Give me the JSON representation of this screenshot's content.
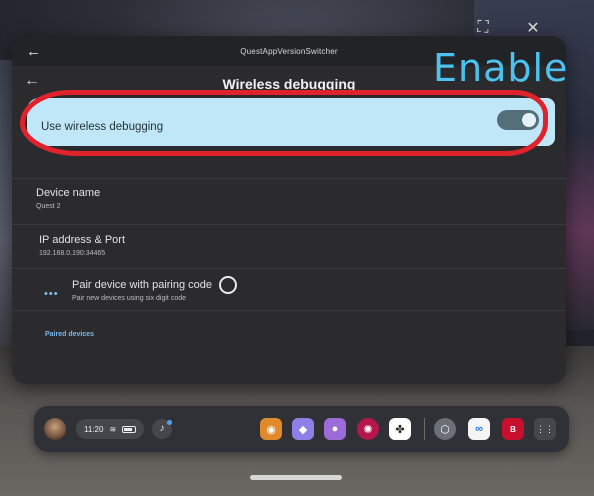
{
  "window": {
    "title": "QuestAppVersionSwitcher",
    "controls": {
      "fullscreen_icon": "⛶",
      "close_icon": "✕"
    }
  },
  "settings": {
    "title": "Wireless debugging",
    "toggle": {
      "label": "Use wireless debugging",
      "state": "on"
    },
    "items": [
      {
        "title": "Device name",
        "subtitle": "Quest 2"
      },
      {
        "title": "IP address & Port",
        "subtitle": "192.168.0.190:34465"
      },
      {
        "title": "Pair device with pairing code",
        "subtitle": "Pair new devices using six digit code"
      }
    ],
    "section_label": "Paired devices"
  },
  "annotation": {
    "text": "Enable",
    "color": "#4cc3ee",
    "outline_color": "#e0222c"
  },
  "taskbar": {
    "time": "11:20",
    "apps": [
      {
        "name": "store-app-icon",
        "color": "#e08a2b",
        "glyph": "◉"
      },
      {
        "name": "explore-app-icon",
        "color": "#8c7fe6",
        "glyph": "◆"
      },
      {
        "name": "people-app-icon",
        "color": "#9b6bd8",
        "glyph": "●"
      },
      {
        "name": "fitness-app-icon",
        "color": "#b5174b",
        "glyph": "✺"
      },
      {
        "name": "mini-app-icon",
        "color": "#ffffff",
        "glyph": "✤"
      },
      {
        "name": "settings-app-icon",
        "color": "#6b6f78",
        "glyph": "⬡"
      },
      {
        "name": "meta-app-icon",
        "color": "#f5f5f5",
        "glyph": "∞"
      },
      {
        "name": "beat-saber-app-icon",
        "color": "#c8102e",
        "glyph": "B"
      },
      {
        "name": "app-library-icon",
        "color": "#45474d",
        "glyph": "⋮⋮"
      }
    ]
  }
}
